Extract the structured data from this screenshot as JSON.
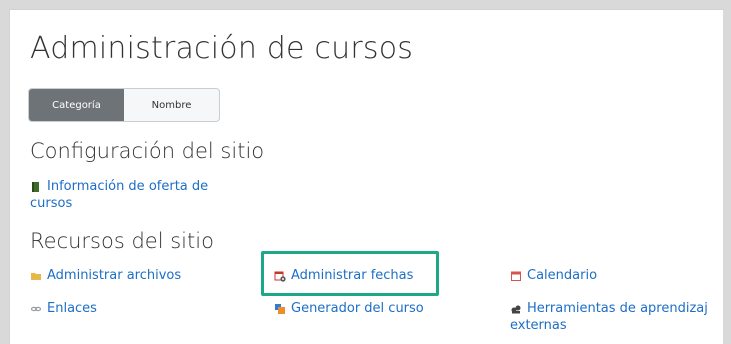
{
  "page": {
    "title": "Administración de cursos"
  },
  "view_toggle": {
    "options": [
      "Categoría",
      "Nombre"
    ],
    "selected": "Categoría"
  },
  "sections": [
    {
      "title": "Configuración del sitio",
      "links": [
        {
          "line1": "Información de oferta de",
          "line2": "cursos",
          "icon": "book-icon"
        }
      ]
    },
    {
      "title": "Recursos del sitio",
      "links": [
        {
          "label": "Administrar archivos",
          "icon": "folder-icon"
        },
        {
          "label": "Administrar fechas",
          "icon": "calendar-gear-icon",
          "highlighted": true
        },
        {
          "label": "Calendario",
          "icon": "calendar-icon"
        },
        {
          "label": "Enlaces",
          "icon": "link-icon"
        },
        {
          "label": "Generador del curso",
          "icon": "course-builder-icon"
        },
        {
          "line1": "Herramientas de aprendizaj",
          "line2": "externas",
          "icon": "external-tools-icon"
        }
      ]
    }
  ],
  "colors": {
    "link": "#1d6ec6",
    "highlight": "#1ea88a",
    "toggle_active": "#6e7378"
  }
}
